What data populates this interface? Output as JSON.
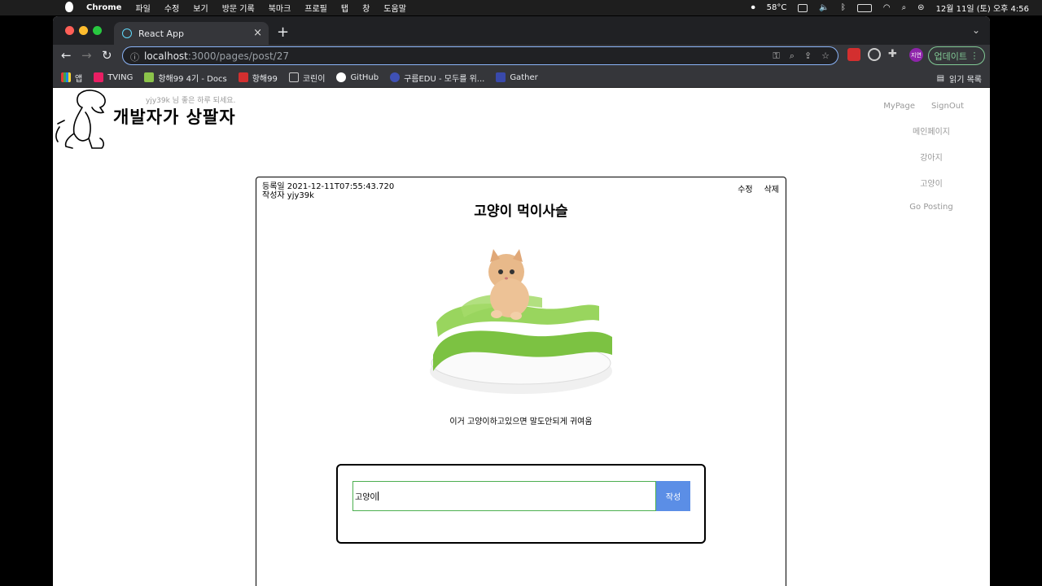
{
  "menubar": {
    "app": "Chrome",
    "items": [
      "파일",
      "수정",
      "보기",
      "방문 기록",
      "북마크",
      "프로필",
      "탭",
      "창",
      "도움말"
    ],
    "temperature": "58°C",
    "datetime": "12월 11일 (토) 오후 4:56"
  },
  "browser": {
    "tab_title": "React App",
    "url_host": "localhost",
    "url_rest": ":3000/pages/post/27",
    "profile_initials": "지연",
    "update_label": "업데이트",
    "bookmarks": [
      "앱",
      "TVING",
      "항해99 4기 - Docs",
      "항해99",
      "코린이",
      "GitHub",
      "구름EDU - 모두를 위...",
      "Gather"
    ],
    "reading_list": "읽기 목록"
  },
  "header": {
    "greeting": "yjy39k 님 좋은 하루 되세요.",
    "logo_text": "개발자가 상팔자"
  },
  "nav": {
    "mypage": "MyPage",
    "signout": "SignOut",
    "links": [
      "메인페이지",
      "강아지",
      "고양이",
      "Go Posting"
    ]
  },
  "post": {
    "date": "등록일 2021-12-11T07:55:43.720",
    "author": "작성자 yjy39k",
    "edit_label": "수정",
    "delete_label": "삭제",
    "title": "고양이 먹이사슬",
    "body": "이거 고양이하고있으면 말도안되게 귀여움"
  },
  "comment": {
    "value": "고양이",
    "submit_label": "작성"
  }
}
